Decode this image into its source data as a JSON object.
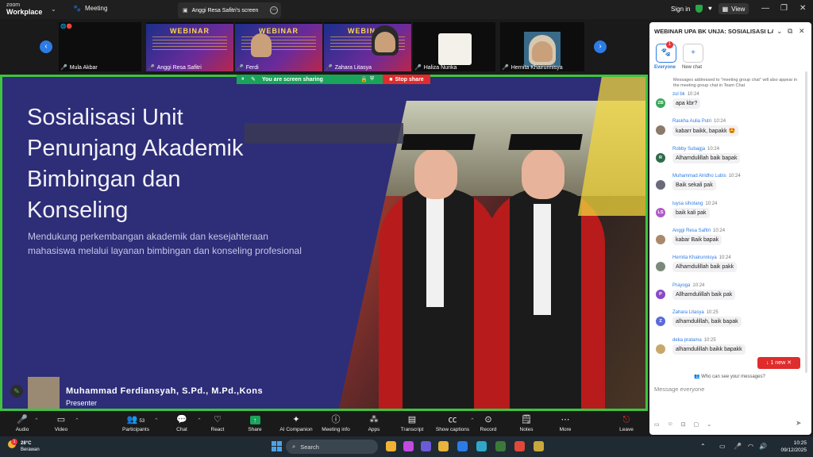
{
  "app": {
    "logo_top": "zoom",
    "logo_bottom": "Workplace",
    "meeting_tab": "Meeting",
    "screen_tab": "Anggi Resa Safitri's screen",
    "sign_in": "Sign in",
    "view": "View"
  },
  "gallery": {
    "tiles": [
      {
        "name": "Mula Akbar"
      },
      {
        "name": "Anggi Resa Safitri"
      },
      {
        "name": "Ferdi"
      },
      {
        "name": "Zahara Litasya"
      },
      {
        "name": "Haliza Nurika"
      },
      {
        "name": "Hernita Khairunnisya"
      }
    ],
    "banner_word": "WEBINAR"
  },
  "sharing": {
    "status": "You are screen sharing",
    "stop": "Stop share"
  },
  "slide": {
    "title_lines": [
      "Sosialisasi Unit",
      "Penunjang Akademik",
      "Bimbingan dan",
      "Konseling"
    ],
    "subtitle_lines": [
      "Mendukung perkembangan akademik dan kesejahteraan",
      "mahasiswa melalui layanan bimbingan dan konseling profesional"
    ],
    "presenter_name": "Muhammad  Ferdiansyah, S.Pd., M.Pd.,Kons",
    "presenter_role": "Presenter"
  },
  "toolbar": {
    "audio": "Audio",
    "video": "Video",
    "participants": "Participants",
    "participants_count": "53",
    "chat": "Chat",
    "react": "React",
    "share": "Share",
    "ai": "AI Companion",
    "info": "Meeting info",
    "apps": "Apps",
    "transcript": "Transcript",
    "captions": "Show captions",
    "record": "Record",
    "notes": "Notes",
    "more": "More",
    "leave": "Leave"
  },
  "chat": {
    "title": "WEBINAR UPA BK UNJA: SOSIALISASI LAYA...",
    "everyone": "Everyone",
    "new_chat": "New chat",
    "everyone_badge": "1",
    "note": "Messages addressed to \"meeting group chat\" will also appear in the meeting group chat in Team Chat",
    "messages": [
      {
        "sender": "zul bk",
        "time": "10:24",
        "text": "apa kbr?",
        "initials": "ZB",
        "color": "#3aa65c"
      },
      {
        "sender": "Raskha Aulia Putri",
        "time": "10:24",
        "text": "kabarr baikk, bapakk 🤩",
        "initials": "",
        "color": "#8a7a6a"
      },
      {
        "sender": "Robby Subagja",
        "time": "10:24",
        "text": "Alhamdulillah baik bapak",
        "initials": "R",
        "color": "#2f6b4a"
      },
      {
        "sender": "Muhammad Alridho Lubis",
        "time": "10:24",
        "text": "Baik sekali pak",
        "initials": "",
        "color": "#6a6a7a"
      },
      {
        "sender": "luysa sihotang",
        "time": "10:24",
        "text": "baik kali pak",
        "initials": "LS",
        "color": "#b05ac8"
      },
      {
        "sender": "Anggi Resa Safitri",
        "time": "10:24",
        "text": "kabar Baik bapak",
        "initials": "",
        "color": "#a88a6a"
      },
      {
        "sender": "Hernita Khairunnisya",
        "time": "10:24",
        "text": "Alhamdulillah baik pakk",
        "initials": "",
        "color": "#7a8a7a"
      },
      {
        "sender": "Prayoga",
        "time": "10:24",
        "text": "Allhamdulillah baik pak",
        "initials": "P",
        "color": "#8a4ac8"
      },
      {
        "sender": "Zahara Litasya",
        "time": "10:25",
        "text": "alhamdulillah, baik bapak",
        "initials": "Z",
        "color": "#5a6ad8"
      },
      {
        "sender": "deka pratama",
        "time": "10:25",
        "text": "alhamdulillah baikk bapakk",
        "initials": "",
        "color": "#c8a86a"
      }
    ],
    "new_badge": "1 new",
    "who_can_see": "Who can see your messages?",
    "input_placeholder": "Message everyone"
  },
  "taskbar": {
    "temp": "28°C",
    "weather": "Berawan",
    "weather_badge": "1",
    "search": "Search",
    "time": "10:25",
    "date": "09/12/2025"
  }
}
